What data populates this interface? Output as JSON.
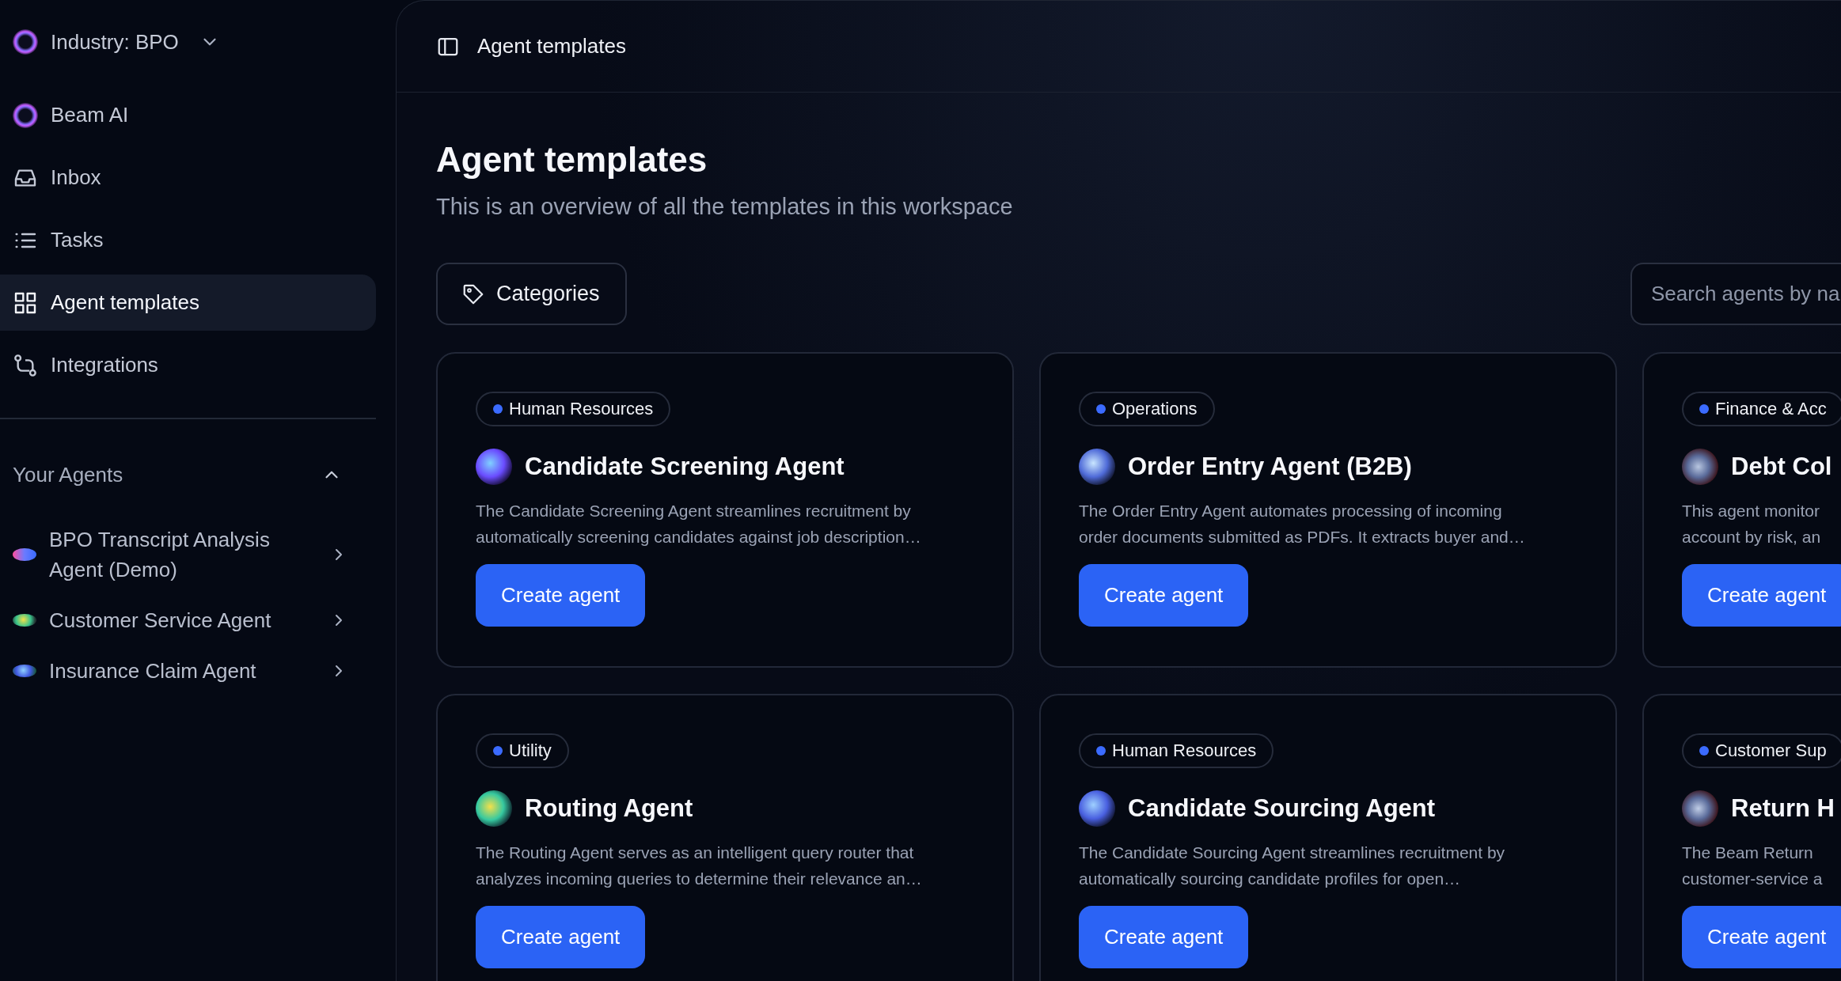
{
  "workspace": {
    "label": "Industry: BPO"
  },
  "nav": [
    {
      "label": "Beam AI",
      "selected": false
    },
    {
      "label": "Inbox",
      "selected": false
    },
    {
      "label": "Tasks",
      "selected": false
    },
    {
      "label": "Agent templates",
      "selected": true
    },
    {
      "label": "Integrations",
      "selected": false
    }
  ],
  "your_agents": {
    "title": "Your Agents",
    "expanded": true,
    "items": [
      {
        "label": "BPO Transcript Analysis Agent (Demo)"
      },
      {
        "label": "Customer Service Agent"
      },
      {
        "label": "Insurance Claim Agent"
      }
    ]
  },
  "header": {
    "title": "Agent templates"
  },
  "page": {
    "title": "Agent templates",
    "subtitle": "This is an overview of all the templates in this workspace"
  },
  "categories_button": "Categories",
  "search": {
    "placeholder": "Search agents by na"
  },
  "cards": [
    {
      "tag": "Human Resources",
      "title": "Candidate Screening Agent",
      "description_lines": [
        "The Candidate Screening Agent streamlines recruitment by",
        "automatically screening candidates against job description…"
      ],
      "button": "Create agent"
    },
    {
      "tag": "Operations",
      "title": "Order Entry Agent (B2B)",
      "description_lines": [
        "The Order Entry Agent automates processing of incoming",
        "order documents submitted as PDFs. It extracts buyer and…"
      ],
      "button": "Create agent"
    },
    {
      "tag": "Finance & Acc",
      "title": "Debt Col",
      "description_lines": [
        "This agent monitor",
        "account by risk, an"
      ],
      "button": "Create agent"
    },
    {
      "tag": "Utility",
      "title": "Routing Agent",
      "description_lines": [
        "The Routing Agent serves as an intelligent query router that",
        "analyzes incoming queries to determine their relevance an…"
      ],
      "button": "Create agent"
    },
    {
      "tag": "Human Resources",
      "title": "Candidate Sourcing Agent",
      "description_lines": [
        "The Candidate Sourcing Agent streamlines recruitment by",
        "automatically sourcing candidate profiles for open…"
      ],
      "button": "Create agent"
    },
    {
      "tag": "Customer Sup",
      "title": "Return H",
      "description_lines": [
        "The Beam Return",
        "customer-service a"
      ],
      "button": "Create agent"
    }
  ]
}
